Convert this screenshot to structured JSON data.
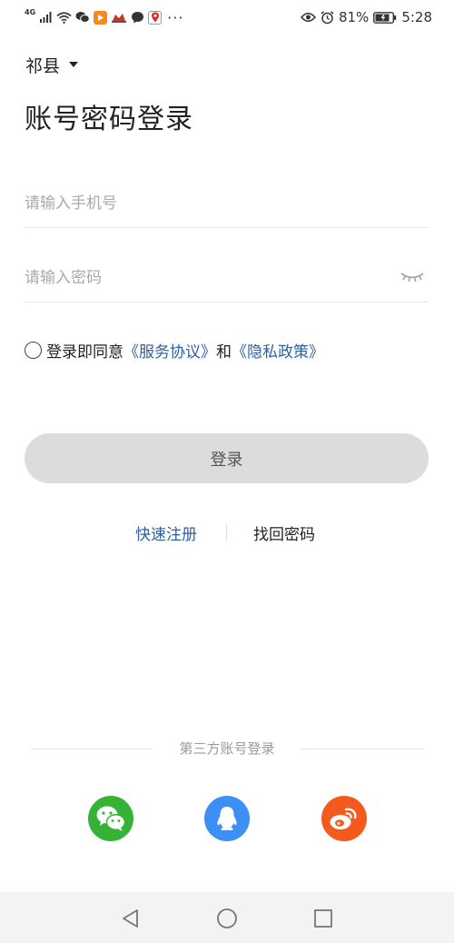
{
  "status_bar": {
    "network": "4G",
    "battery": "81%",
    "time": "5:28",
    "more": "···"
  },
  "city": {
    "name": "祁县"
  },
  "title": "账号密码登录",
  "phone_field": {
    "placeholder": "请输入手机号",
    "value": ""
  },
  "password_field": {
    "placeholder": "请输入密码",
    "value": ""
  },
  "agreement": {
    "prefix": "登录即同意",
    "service_link": "《服务协议》",
    "and": "和",
    "privacy_link": "《隐私政策》"
  },
  "login_button": "登录",
  "links": {
    "register": "快速注册",
    "forgot": "找回密码"
  },
  "third_party": {
    "label": "第三方账号登录"
  },
  "colors": {
    "accent_link": "#2e5fa3",
    "wechat": "#34b337",
    "qq": "#3b8ff5",
    "weibo": "#f45a1c",
    "button_bg": "#dcdcdc"
  },
  "icons": [
    "signal-icon",
    "wifi-icon",
    "wechat-notification-icon",
    "video-app-icon",
    "app-icon",
    "message-icon",
    "location-app-icon",
    "eye-icon",
    "alarm-icon",
    "battery-icon",
    "eye-closed-icon",
    "wechat-icon",
    "qq-icon",
    "weibo-icon",
    "back-icon",
    "home-icon",
    "recent-apps-icon"
  ]
}
